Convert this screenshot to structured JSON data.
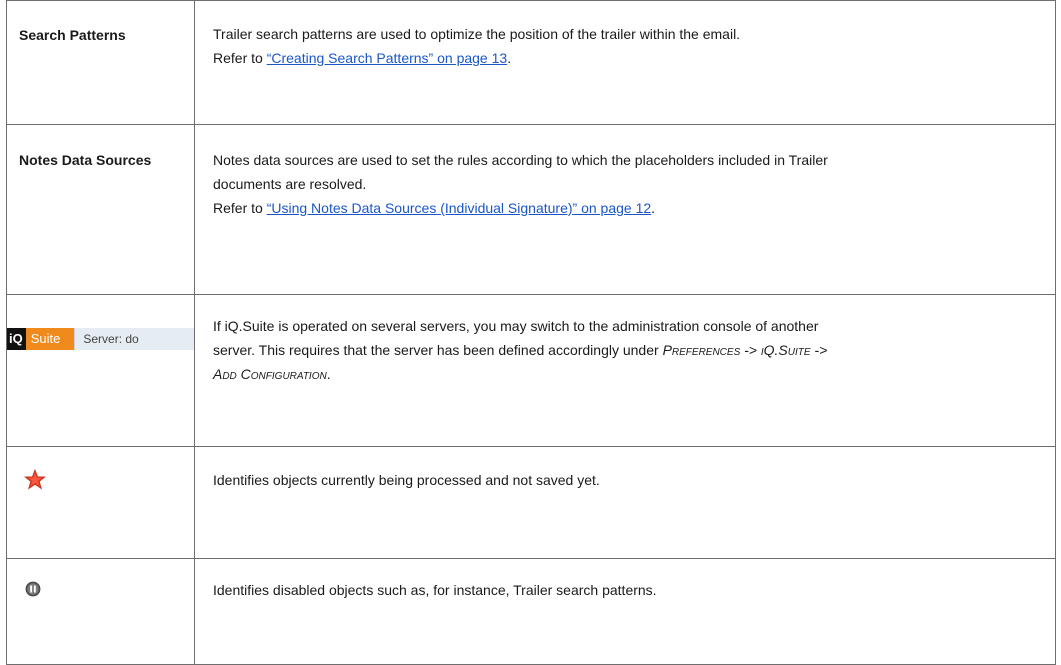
{
  "rows": [
    {
      "term": "Search Patterns",
      "desc_lines": [
        "Trailer search patterns are used to optimize the position of the trailer within the email."
      ],
      "refer_prefix": "Refer to ",
      "refer_link": "“Creating Search Patterns” on page 13",
      "refer_suffix": "."
    },
    {
      "term": "Notes Data Sources",
      "desc_lines": [
        "Notes data sources are used to set the rules according to which the placeholders included in Trailer",
        "documents are resolved."
      ],
      "refer_prefix": "Refer to ",
      "refer_link": "“Using Notes Data Sources (Individual Signature)” on page 12",
      "refer_suffix": "."
    },
    {
      "toolbar": {
        "iq": "iQ",
        "suite": "Suite",
        "server": "Server: do"
      },
      "desc_line1": "If iQ.Suite is operated on several servers, you may switch to the administration console of another",
      "desc_line2_prefix": "server. This requires that the server has been defined accordingly under ",
      "menu_path_1": "Preferences -> iQ.Suite ->",
      "menu_path_2": "Add Configuration",
      "desc_end": "."
    },
    {
      "icon": "modified-star-icon",
      "desc": "Identifies objects currently being processed and not saved yet."
    },
    {
      "icon": "disabled-pause-icon",
      "desc": "Identifies disabled objects such as, for instance, Trailer search patterns."
    }
  ],
  "colors": {
    "link": "#1a56c9",
    "suite_orange": "#f08a1c",
    "star_red": "#e8402a",
    "border": "#6e6e6e"
  }
}
